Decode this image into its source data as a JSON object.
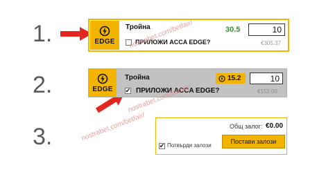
{
  "steps": [
    "1.",
    "2.",
    "3."
  ],
  "edge_label": "EDGE",
  "bet_name": "Тройна",
  "watermark": "nostrabet.com/betfair/",
  "panel1": {
    "odds": "30.5",
    "stake": "10",
    "apply_label": "ПРИЛОЖИ ACCA EDGE?",
    "return": "€305.37",
    "checkbox_checked": false
  },
  "panel2": {
    "odds": "15.2",
    "stake": "10",
    "apply_label": "ПРИЛОЖИ ACCA EDGE?",
    "return": "€152.00",
    "checkbox_checked": true
  },
  "panel3": {
    "total_label": "Общ залог:",
    "total_value": "€0.00",
    "confirm_label": "Потвърди залози",
    "place_button": "Постави залози",
    "confirm_checked": true
  },
  "colors": {
    "accent": "#f3b400",
    "arrow": "#e3261f",
    "odds_green": "#2a9a2a"
  },
  "icons": [
    "lightning-icon",
    "checkbox-icon",
    "arrow-icon"
  ]
}
